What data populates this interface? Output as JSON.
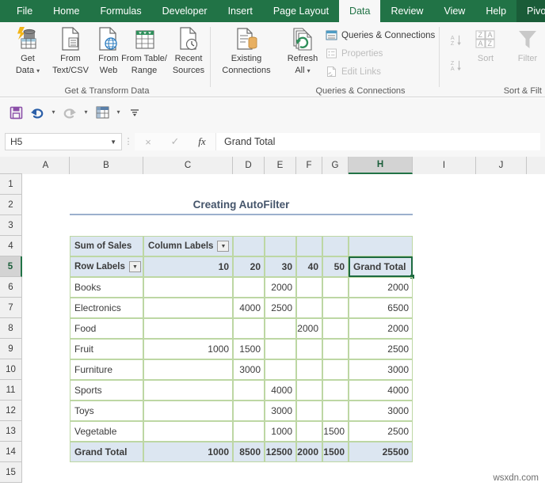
{
  "ribbon": {
    "tabs": [
      {
        "label": "File",
        "active": false
      },
      {
        "label": "Home",
        "active": false
      },
      {
        "label": "Formulas",
        "active": false
      },
      {
        "label": "Developer",
        "active": false
      },
      {
        "label": "Insert",
        "active": false
      },
      {
        "label": "Page Layout",
        "active": false
      },
      {
        "label": "Data",
        "active": true
      },
      {
        "label": "Review",
        "active": false
      },
      {
        "label": "View",
        "active": false
      },
      {
        "label": "Help",
        "active": false
      },
      {
        "label": "Pivot",
        "active": false
      }
    ],
    "groups": [
      {
        "caption": "Get & Transform Data"
      },
      {
        "caption": "Queries & Connections"
      },
      {
        "caption": "Sort & Filt"
      }
    ],
    "get_transform": {
      "get_data_line1": "Get",
      "get_data_line2": "Data",
      "from_textcsv_line1": "From",
      "from_textcsv_line2": "Text/CSV",
      "from_web_line1": "From",
      "from_web_line2": "Web",
      "from_table_line1": "From Table/",
      "from_table_line2": "Range",
      "recent_sources_line1": "Recent",
      "recent_sources_line2": "Sources",
      "existing_connections_line1": "Existing",
      "existing_connections_line2": "Connections"
    },
    "queries": {
      "refresh_all_line1": "Refresh",
      "refresh_all_line2": "All",
      "queries_connections": "Queries & Connections",
      "properties": "Properties",
      "edit_links": "Edit Links"
    },
    "sortfilter": {
      "sort_az": "A↓",
      "sort_za": "Z↓",
      "sort": "Sort",
      "filter": "Filter"
    }
  },
  "quick_access": {
    "save": "save-icon",
    "undo": "undo-icon",
    "redo": "redo-icon",
    "pivot": "pivot-icon",
    "more": "more-icon"
  },
  "formula_bar": {
    "name_box": "H5",
    "cancel": "×",
    "enter": "✓",
    "fx": "fx",
    "formula_value": "Grand Total"
  },
  "grid": {
    "columns": [
      "A",
      "B",
      "C",
      "D",
      "E",
      "F",
      "G",
      "H",
      "I",
      "J"
    ],
    "selected_column": "H",
    "rows": [
      "1",
      "2",
      "3",
      "4",
      "5",
      "6",
      "7",
      "8",
      "9",
      "10",
      "11",
      "12",
      "13",
      "14",
      "15"
    ],
    "selected_row": "5"
  },
  "sheet": {
    "title": "Creating AutoFilter",
    "pivot": {
      "corner_label": "Sum of Sales",
      "column_labels": "Column Labels",
      "row_labels": "Row Labels",
      "col_headers": [
        "10",
        "20",
        "30",
        "40",
        "50"
      ],
      "grand_total_header": "Grand Total",
      "grand_total_row_label": "Grand Total",
      "rows": [
        {
          "label": "Books",
          "values": [
            "",
            "",
            "2000",
            "",
            ""
          ],
          "total": "2000"
        },
        {
          "label": "Electronics",
          "values": [
            "",
            "4000",
            "2500",
            "",
            ""
          ],
          "total": "6500"
        },
        {
          "label": "Food",
          "values": [
            "",
            "",
            "",
            "2000",
            ""
          ],
          "total": "2000"
        },
        {
          "label": "Fruit",
          "values": [
            "1000",
            "1500",
            "",
            "",
            ""
          ],
          "total": "2500"
        },
        {
          "label": "Furniture",
          "values": [
            "",
            "3000",
            "",
            "",
            ""
          ],
          "total": "3000"
        },
        {
          "label": "Sports",
          "values": [
            "",
            "",
            "4000",
            "",
            ""
          ],
          "total": "4000"
        },
        {
          "label": "Toys",
          "values": [
            "",
            "",
            "3000",
            "",
            ""
          ],
          "total": "3000"
        },
        {
          "label": "Vegetable",
          "values": [
            "",
            "",
            "1000",
            "",
            "1500"
          ],
          "total": "2500"
        }
      ],
      "totals": [
        "1000",
        "8500",
        "12500",
        "2000",
        "1500"
      ],
      "grand_total": "25500"
    }
  },
  "watermark": "wsxdn.com",
  "colors": {
    "ribbon_green": "#217346",
    "pivot_header_fill": "#dce6f1",
    "pivot_border": "#bdd7a4",
    "selection_green": "#1e6b41",
    "title_text": "#44546a"
  }
}
